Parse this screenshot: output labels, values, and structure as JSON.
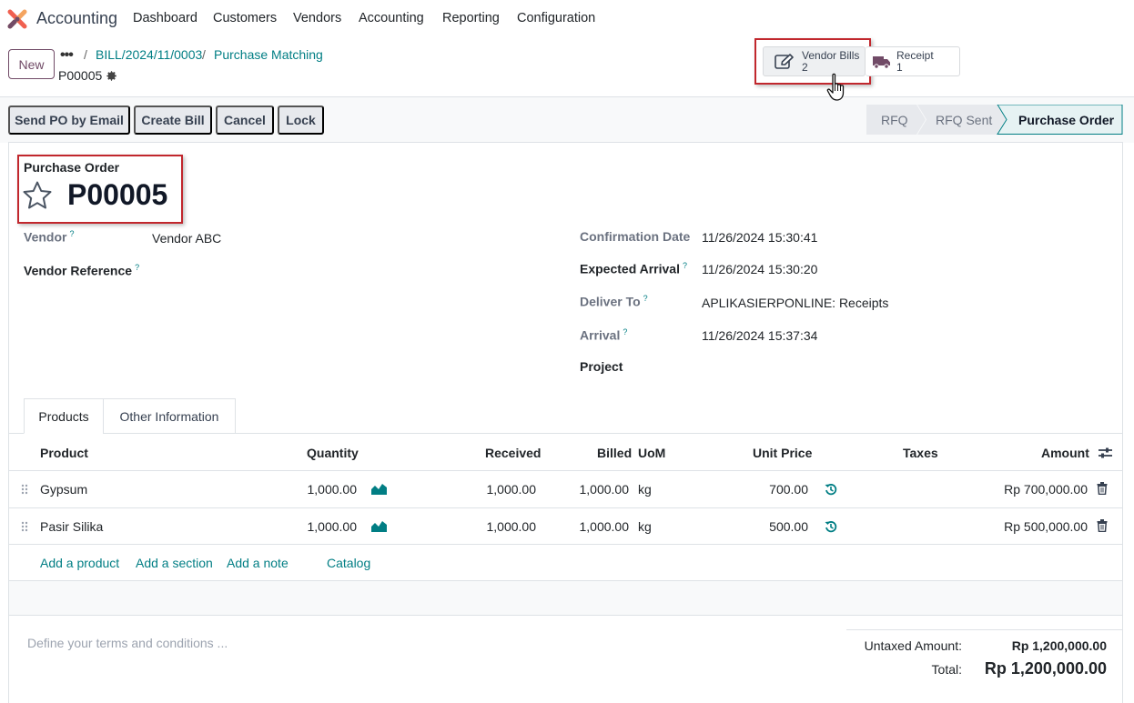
{
  "app": {
    "name": "Accounting"
  },
  "menu": [
    "Dashboard",
    "Customers",
    "Vendors",
    "Accounting",
    "Reporting",
    "Configuration"
  ],
  "control": {
    "new_label": "New",
    "breadcrumbs": [
      "BILL/2024/11/0003",
      "Purchase Matching"
    ],
    "record": "P00005"
  },
  "smart_buttons": {
    "vendor_bills": {
      "label": "Vendor Bills",
      "count": "2"
    },
    "receipt": {
      "label": "Receipt",
      "count": "1"
    }
  },
  "actions": [
    "Send PO by Email",
    "Create Bill",
    "Cancel",
    "Lock"
  ],
  "stages": [
    {
      "label": "RFQ",
      "active": false
    },
    {
      "label": "RFQ Sent",
      "active": false
    },
    {
      "label": "Purchase Order",
      "active": true
    }
  ],
  "form": {
    "title_label": "Purchase Order",
    "title": "P00005",
    "vendor_label": "Vendor",
    "vendor_value": "Vendor ABC",
    "vendor_ref_label": "Vendor Reference",
    "confirmation_label": "Confirmation Date",
    "confirmation_value": "11/26/2024 15:30:41",
    "expected_label": "Expected Arrival",
    "expected_value": "11/26/2024 15:30:20",
    "deliver_label": "Deliver To",
    "deliver_value": "APLIKASIERPONLINE: Receipts",
    "arrival_label": "Arrival",
    "arrival_value": "11/26/2024 15:37:34",
    "project_label": "Project",
    "help_mark": "?"
  },
  "tabs": [
    "Products",
    "Other Information"
  ],
  "table": {
    "headers": [
      "Product",
      "Quantity",
      "Received",
      "Billed",
      "UoM",
      "Unit Price",
      "Taxes",
      "Amount"
    ],
    "rows": [
      {
        "product": "Gypsum",
        "quantity": "1,000.00",
        "received": "1,000.00",
        "billed": "1,000.00",
        "uom": "kg",
        "unit_price": "700.00",
        "amount": "Rp 700,000.00"
      },
      {
        "product": "Pasir Silika",
        "quantity": "1,000.00",
        "received": "1,000.00",
        "billed": "1,000.00",
        "uom": "kg",
        "unit_price": "500.00",
        "amount": "Rp 500,000.00"
      }
    ],
    "add_links": [
      "Add a product",
      "Add a section",
      "Add a note",
      "Catalog"
    ]
  },
  "footer": {
    "terms_placeholder": "Define your terms and conditions ...",
    "untaxed_label": "Untaxed Amount:",
    "untaxed_value": "Rp 1,200,000.00",
    "total_label": "Total:",
    "total_value": "Rp 1,200,000.00"
  },
  "colors": {
    "brand": "#714b67",
    "link": "#017e84",
    "highlight": "#c1272d"
  }
}
